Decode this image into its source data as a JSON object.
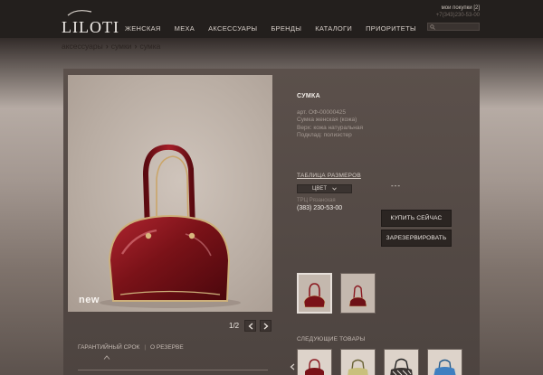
{
  "header": {
    "logo": "LILOTI",
    "nav": [
      "ЖЕНСКАЯ",
      "МЕХА",
      "АКСЕССУАРЫ",
      "БРЕНДЫ",
      "КАТАЛОГИ",
      "ПРИОРИТЕТЫ"
    ],
    "cart_link": "мои покупки [2]",
    "phone": "+7(343)230-53-00"
  },
  "breadcrumb": [
    "аксессуары",
    "сумки",
    "сумка"
  ],
  "gallery": {
    "badge": "new",
    "counter": "1/2"
  },
  "product": {
    "title": "СУМКА",
    "description": [
      "арт. ОФ-00000425",
      "Сумка женская (кожа)",
      "Верх: кожа натуральная",
      "Подклад: полиэстер"
    ],
    "size_table_link": "ТАБЛИЦА РАЗМЕРОВ",
    "color_label": "ЦВЕТ",
    "placeholder_dashes": "---",
    "store_name": "ТРЦ Рязанская",
    "store_phone": "(383) 230-53-00",
    "buy_button": "КУПИТЬ СЕЙЧАС",
    "reserve_button": "ЗАРЕЗЕРВИРОВАТЬ"
  },
  "tabs": [
    "ГАРАНТИЙНЫЙ СРОК",
    "О РЕЗЕРВЕ"
  ],
  "next_products_label": "СЛЕДУЮЩИЕ ТОВАРЫ",
  "colors": {
    "bag_red": "#7a1218",
    "header_bg": "#231f1d",
    "button_bg": "#2b2522"
  }
}
